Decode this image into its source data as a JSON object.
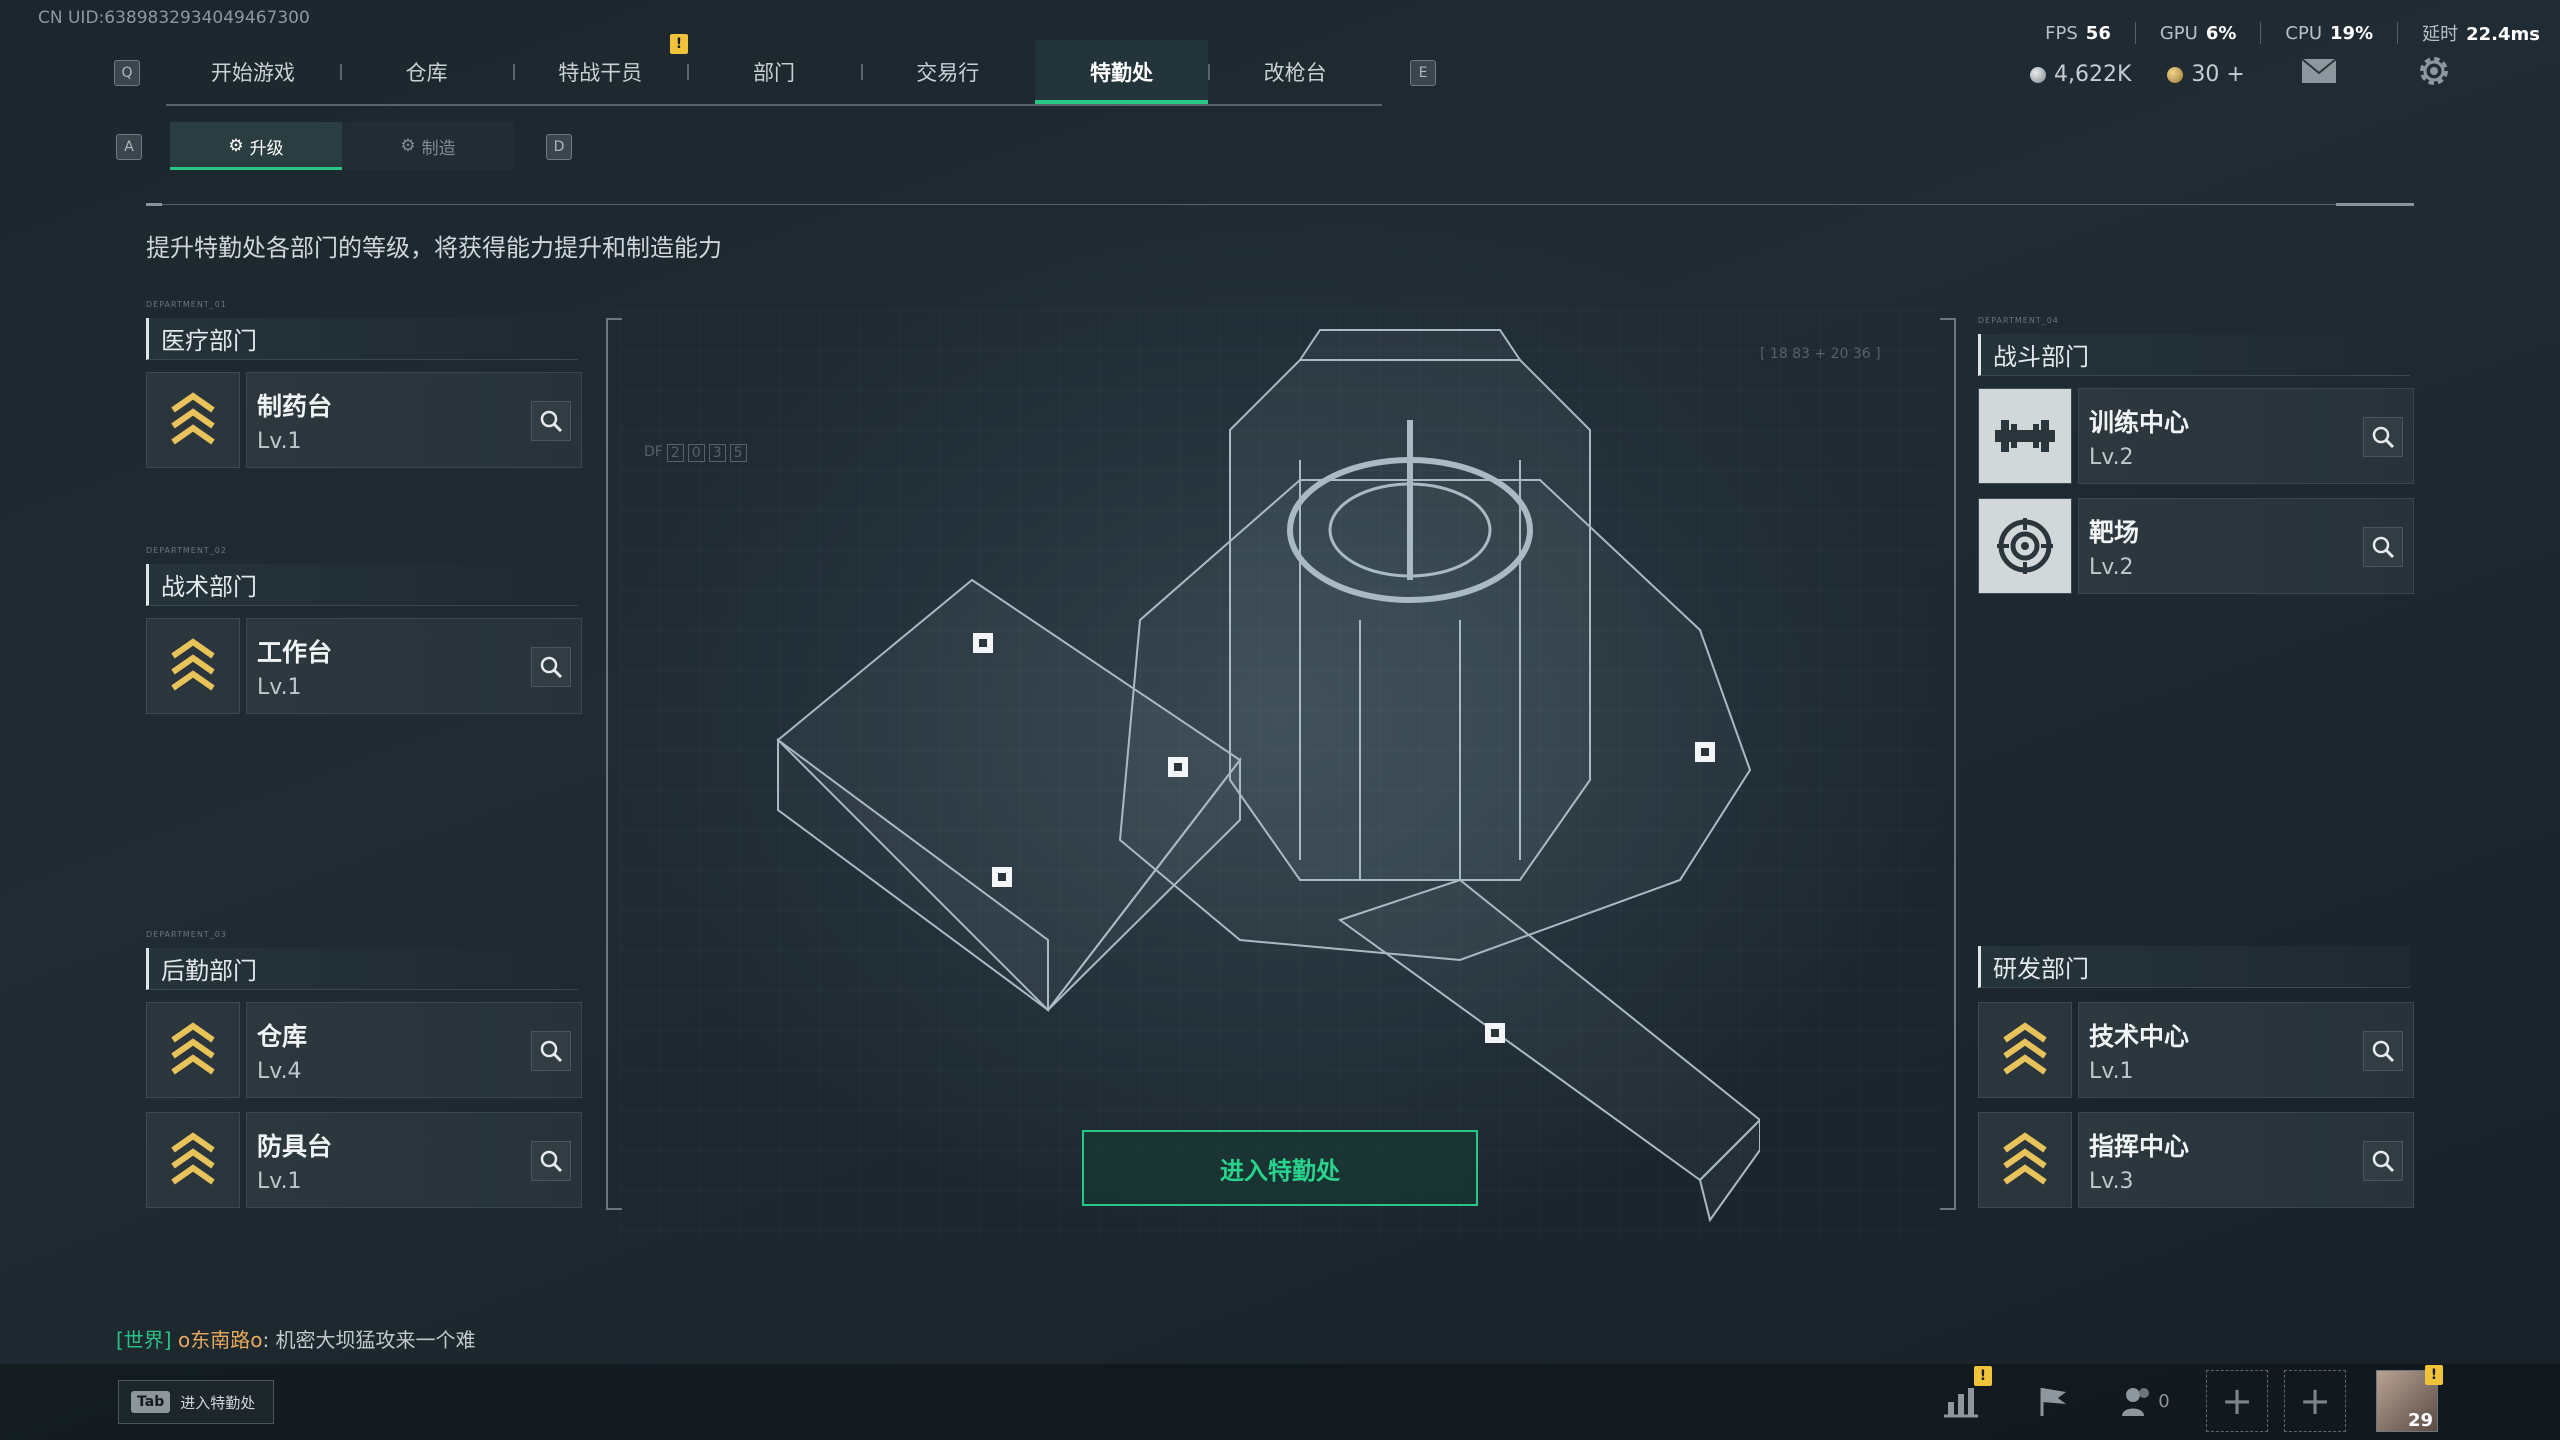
{
  "uid": "CN UID:6389832934049467300",
  "nav": {
    "key_left": "Q",
    "key_right": "E",
    "alert": "!",
    "items": [
      "开始游戏",
      "仓库",
      "特战干员",
      "部门",
      "交易行",
      "特勤处",
      "改枪台"
    ],
    "active": "特勤处"
  },
  "stats": {
    "fps_label": "FPS",
    "fps": "56",
    "gpu_label": "GPU",
    "gpu": "6%",
    "cpu_label": "CPU",
    "cpu": "19%",
    "latency_label": "延时",
    "latency": "22.4ms"
  },
  "currency": {
    "silver": "4,622K",
    "gold": "30"
  },
  "subtabs": {
    "key_left": "A",
    "key_right": "D",
    "upgrade": "升级",
    "craft": "制造"
  },
  "description": "提升特勤处各部门的等级，将获得能力提升和制造能力",
  "departments": {
    "medical": {
      "tag": "DEPARTMENT_01",
      "title": "医疗部门",
      "items": [
        {
          "name": "制药台",
          "level": "Lv.1"
        }
      ]
    },
    "tactical": {
      "tag": "DEPARTMENT_02",
      "title": "战术部门",
      "items": [
        {
          "name": "工作台",
          "level": "Lv.1"
        }
      ]
    },
    "logistics": {
      "tag": "DEPARTMENT_03",
      "title": "后勤部门",
      "items": [
        {
          "name": "仓库",
          "level": "Lv.4"
        },
        {
          "name": "防具台",
          "level": "Lv.1"
        }
      ]
    },
    "combat": {
      "tag": "DEPARTMENT_04",
      "title": "战斗部门",
      "items": [
        {
          "name": "训练中心",
          "level": "Lv.2"
        },
        {
          "name": "靶场",
          "level": "Lv.2"
        }
      ]
    },
    "research": {
      "title": "研发部门",
      "items": [
        {
          "name": "技术中心",
          "level": "Lv.1"
        },
        {
          "name": "指挥中心",
          "level": "Lv.3"
        }
      ]
    }
  },
  "map_deco": {
    "coords": "[ 18 83 + 20 36 ]",
    "df_label": "DF",
    "df_cells": [
      "2",
      "0",
      "3",
      "5"
    ]
  },
  "enter_button": "进入特勤处",
  "chat": {
    "channel": "[世界]",
    "user": "o东南路o",
    "message": ": 机密大坝猛攻来一个难"
  },
  "tab_hint": {
    "key": "Tab",
    "label": "进入特勤处"
  },
  "bottom": {
    "friends_count": "0",
    "level": "29"
  }
}
